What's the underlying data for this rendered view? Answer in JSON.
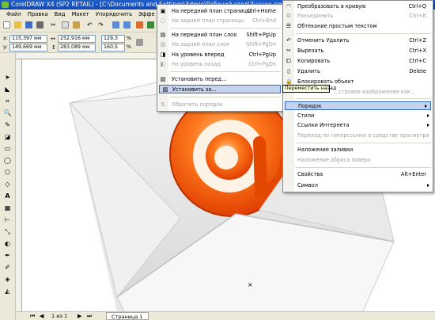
{
  "window": {
    "title": "CorelDRAW X4 (SP2 RETAIL) - [C:\\Documents and Settings\\Admin\\Рабочий стол\\Значок почты\\Значок..."
  },
  "menubar": {
    "items": [
      "Файл",
      "Правка",
      "Вид",
      "Макет",
      "Упорядочить",
      "Эффе"
    ]
  },
  "propbar": {
    "x_label": "x:",
    "x_value": "115,397 мм",
    "y_label": "y:",
    "y_value": "149,669 мм",
    "w_value": "252,916 мм",
    "h_value": "283,089 мм",
    "sx_value": "129,3",
    "sy_value": "160,5",
    "pct": "%"
  },
  "order_submenu": {
    "items": [
      {
        "label": "На передний план страницы",
        "shortcut": "Ctrl+Home",
        "disabled": false,
        "icon": "bring-to-front-page-icon"
      },
      {
        "label": "На задний план страницы",
        "shortcut": "Ctrl+End",
        "disabled": true,
        "icon": "send-to-back-page-icon"
      },
      {
        "label": "На передний план слоя",
        "shortcut": "Shift+PgUp",
        "disabled": false,
        "icon": "bring-to-front-layer-icon"
      },
      {
        "label": "На задний план слоя",
        "shortcut": "Shift+PgDn",
        "disabled": true,
        "icon": "send-to-back-layer-icon"
      },
      {
        "label": "На уровень вперед",
        "shortcut": "Ctrl+PgUp",
        "disabled": false,
        "icon": "forward-one-icon"
      },
      {
        "label": "На уровень назад",
        "shortcut": "Ctrl+PgDn",
        "disabled": true,
        "icon": "back-one-icon"
      },
      {
        "label": "Установить перед...",
        "shortcut": "",
        "disabled": false,
        "icon": "in-front-of-icon"
      },
      {
        "label": "Установить за...",
        "shortcut": "",
        "disabled": false,
        "icon": "behind-icon"
      },
      {
        "label": "Обратить порядок",
        "shortcut": "",
        "disabled": true,
        "icon": "reverse-order-icon"
      }
    ]
  },
  "context_menu": {
    "items": [
      {
        "label": "Преобразовать в кривую",
        "shortcut": "Ctrl+Q",
        "disabled": false
      },
      {
        "label": "Разъединить",
        "shortcut": "Ctrl+K",
        "disabled": true
      },
      {
        "label": "Обтекание простым текстом",
        "shortcut": "",
        "disabled": false
      },
      {
        "label": "Отменить Удалить",
        "shortcut": "Ctrl+Z",
        "disabled": false
      },
      {
        "label": "Вырезать",
        "shortcut": "Ctrl+X",
        "disabled": false
      },
      {
        "label": "Копировать",
        "shortcut": "Ctrl+C",
        "disabled": false
      },
      {
        "label": "Удалить",
        "shortcut": "Delete",
        "disabled": false
      },
      {
        "label": "Блокировать объект",
        "shortcut": "",
        "disabled": false
      },
      {
        "label": "...стровое изображение как...",
        "shortcut": "",
        "disabled": true
      },
      {
        "label": "Порядок",
        "shortcut": "",
        "disabled": false
      },
      {
        "label": "Стили",
        "shortcut": "",
        "disabled": false
      },
      {
        "label": "Ссылки Интернета",
        "shortcut": "",
        "disabled": false
      },
      {
        "label": "Переход по гиперссылке в средстве просмотра",
        "shortcut": "",
        "disabled": true
      },
      {
        "label": "Наложение заливки",
        "shortcut": "",
        "disabled": false
      },
      {
        "label": "Наложение абриса поверх",
        "shortcut": "",
        "disabled": true
      },
      {
        "label": "Свойства",
        "shortcut": "Alt+Enter",
        "disabled": false
      },
      {
        "label": "Символ",
        "shortcut": "",
        "disabled": false
      }
    ]
  },
  "tooltip": {
    "text": "Переместить назад"
  },
  "pagebar": {
    "page_count": "1 из 1",
    "page_tab": "Страница 1"
  },
  "artwork": {
    "symbol": "@"
  },
  "colors": {
    "titlebar": "#1f5ec9",
    "highlight": "#c5d3ef",
    "highlight_border": "#3169c6",
    "accent_orange": "#ff5a00"
  }
}
